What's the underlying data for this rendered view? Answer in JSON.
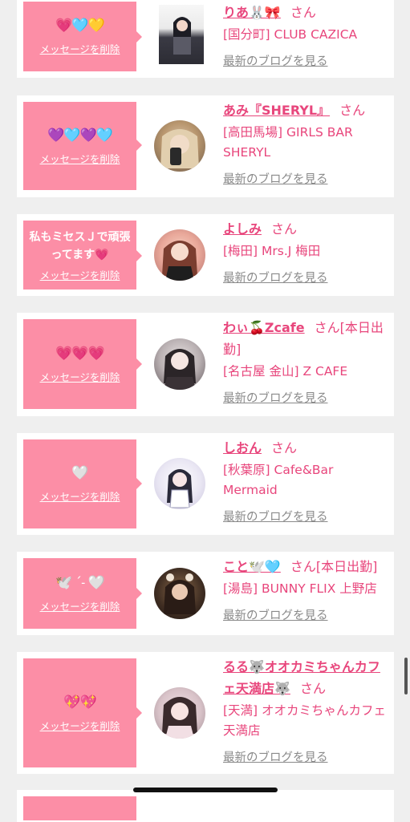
{
  "cards": [
    {
      "message_emoji": "💗🩵💛",
      "delete_label": "メッセージを削除",
      "name": "りあ🐰🎀",
      "san": "さん",
      "extra": "",
      "shop": "[国分町] CLUB CAZICA",
      "blog": "最新のブログを見る"
    },
    {
      "message_emoji": "💜🩵💜🩵",
      "delete_label": "メッセージを削除",
      "name": "あみ『SHERYL』",
      "san": "さん",
      "extra": "",
      "shop": "[高田馬場] GIRLS BAR SHERYL",
      "blog": "最新のブログを見る"
    },
    {
      "message_text": "私もミセスＪで頑張ってます💗",
      "delete_label": "メッセージを削除",
      "name": "よしみ",
      "san": "さん",
      "extra": "",
      "shop": "[梅田] Mrs.J 梅田",
      "blog": "最新のブログを見る"
    },
    {
      "message_emoji": "💗💗💗",
      "delete_label": "メッセージを削除",
      "name": "わぃ🍒Zcafe",
      "san": "さん",
      "extra": "[本日出勤]",
      "shop": "[名古屋 金山] Z CAFE",
      "blog": "最新のブログを見る"
    },
    {
      "message_emoji": "🤍",
      "delete_label": "メッセージを削除",
      "name": "しおん",
      "san": "さん",
      "extra": "",
      "shop": "[秋葉原] Cafe&Bar Mermaid",
      "blog": "最新のブログを見る"
    },
    {
      "message_emoji": "🕊️ ˊ˗ 🤍",
      "delete_label": "メッセージを削除",
      "name": "こと🕊️🩵",
      "san": "さん",
      "extra": "[本日出勤]",
      "shop": "[湯島] BUNNY FLIX 上野店",
      "blog": "最新のブログを見る"
    },
    {
      "message_emoji": "💖💖",
      "delete_label": "メッセージを削除",
      "name": "るる🐺オオカミちゃんカフェ天満店🐺",
      "san": "さん",
      "extra": "",
      "shop": "[天満] オオカミちゃんカフェ天満店",
      "blog": "最新のブログを見る"
    }
  ]
}
